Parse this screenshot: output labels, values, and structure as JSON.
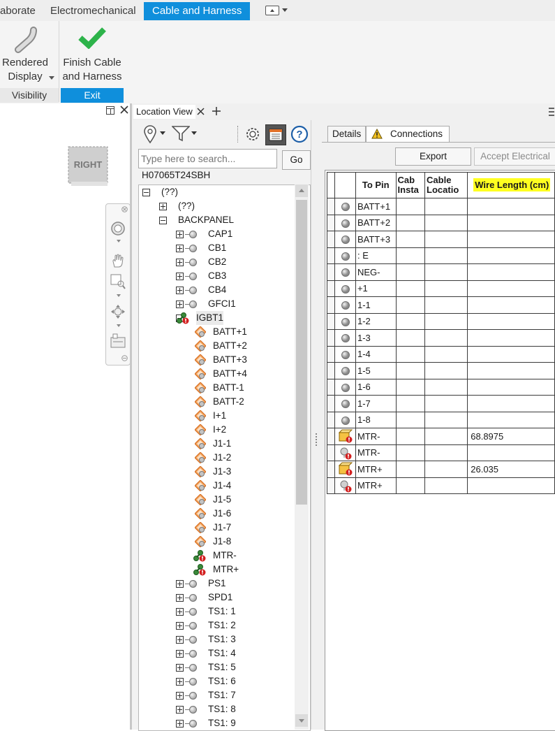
{
  "ribbon": {
    "tabs": [
      "aborate",
      "Electromechanical",
      "Cable and Harness"
    ],
    "active_tab": "Cable and Harness",
    "rendered_display_line1": "Rendered",
    "rendered_display_line2": "Display",
    "finish_line1": "Finish Cable",
    "finish_line2": "and Harness",
    "visibility_label": "Visibility",
    "exit_label": "Exit"
  },
  "viewcube": {
    "face_label": "RIGHT"
  },
  "location_view": {
    "tab_label": "Location View",
    "search_placeholder": "Type here to search...",
    "go_label": "Go",
    "assembly_name": "H07065T24SBH",
    "tree": [
      {
        "level": 0,
        "expander": "minus",
        "icon": "none",
        "label": "(??)"
      },
      {
        "level": 1,
        "expander": "plus",
        "icon": "none",
        "label": "(??)"
      },
      {
        "level": 1,
        "expander": "minus",
        "icon": "none",
        "label": "BACKPANEL"
      },
      {
        "level": 2,
        "expander": "plus",
        "icon": "node",
        "label": "CAP1"
      },
      {
        "level": 2,
        "expander": "plus",
        "icon": "node",
        "label": "CB1"
      },
      {
        "level": 2,
        "expander": "plus",
        "icon": "node",
        "label": "CB2"
      },
      {
        "level": 2,
        "expander": "plus",
        "icon": "node",
        "label": "CB3"
      },
      {
        "level": 2,
        "expander": "plus",
        "icon": "node",
        "label": "CB4"
      },
      {
        "level": 2,
        "expander": "plus",
        "icon": "node",
        "label": "GFCI1"
      },
      {
        "level": 2,
        "expander": "minus",
        "icon": "wire-error",
        "label": "IGBT1"
      },
      {
        "level": 3,
        "expander": "none",
        "icon": "pin",
        "label": "BATT+1"
      },
      {
        "level": 3,
        "expander": "none",
        "icon": "pin",
        "label": "BATT+2"
      },
      {
        "level": 3,
        "expander": "none",
        "icon": "pin",
        "label": "BATT+3"
      },
      {
        "level": 3,
        "expander": "none",
        "icon": "pin",
        "label": "BATT+4"
      },
      {
        "level": 3,
        "expander": "none",
        "icon": "pin",
        "label": "BATT-1"
      },
      {
        "level": 3,
        "expander": "none",
        "icon": "pin",
        "label": "BATT-2"
      },
      {
        "level": 3,
        "expander": "none",
        "icon": "pin",
        "label": "I+1"
      },
      {
        "level": 3,
        "expander": "none",
        "icon": "pin",
        "label": "I+2"
      },
      {
        "level": 3,
        "expander": "none",
        "icon": "pin",
        "label": "J1-1"
      },
      {
        "level": 3,
        "expander": "none",
        "icon": "pin",
        "label": "J1-2"
      },
      {
        "level": 3,
        "expander": "none",
        "icon": "pin",
        "label": "J1-3"
      },
      {
        "level": 3,
        "expander": "none",
        "icon": "pin",
        "label": "J1-4"
      },
      {
        "level": 3,
        "expander": "none",
        "icon": "pin",
        "label": "J1-5"
      },
      {
        "level": 3,
        "expander": "none",
        "icon": "pin",
        "label": "J1-6"
      },
      {
        "level": 3,
        "expander": "none",
        "icon": "pin",
        "label": "J1-7"
      },
      {
        "level": 3,
        "expander": "none",
        "icon": "pin",
        "label": "J1-8"
      },
      {
        "level": 3,
        "expander": "none",
        "icon": "wire-error",
        "label": "MTR-"
      },
      {
        "level": 3,
        "expander": "none",
        "icon": "wire-error",
        "label": "MTR+"
      },
      {
        "level": 2,
        "expander": "plus",
        "icon": "node",
        "label": "PS1"
      },
      {
        "level": 2,
        "expander": "plus",
        "icon": "node",
        "label": "SPD1"
      },
      {
        "level": 2,
        "expander": "plus",
        "icon": "node",
        "label": "TS1: 1"
      },
      {
        "level": 2,
        "expander": "plus",
        "icon": "node",
        "label": "TS1: 2"
      },
      {
        "level": 2,
        "expander": "plus",
        "icon": "node",
        "label": "TS1: 3"
      },
      {
        "level": 2,
        "expander": "plus",
        "icon": "node",
        "label": "TS1: 4"
      },
      {
        "level": 2,
        "expander": "plus",
        "icon": "node",
        "label": "TS1: 5"
      },
      {
        "level": 2,
        "expander": "plus",
        "icon": "node",
        "label": "TS1: 6"
      },
      {
        "level": 2,
        "expander": "plus",
        "icon": "node",
        "label": "TS1: 7"
      },
      {
        "level": 2,
        "expander": "plus",
        "icon": "node",
        "label": "TS1: 8"
      },
      {
        "level": 2,
        "expander": "plus",
        "icon": "node",
        "label": "TS1: 9"
      }
    ]
  },
  "connections": {
    "details_tab": "Details",
    "connections_tab": "Connections",
    "export_label": "Export",
    "accept_label": "Accept Electrical",
    "headers": {
      "to_pin": "To Pin",
      "cable_inst_1": "Cab",
      "cable_inst_2": "Insta",
      "cable_loc_1": "Cable",
      "cable_loc_2": "Locatio",
      "wire_length": "Wire Length (cm)"
    },
    "rows": [
      {
        "icon": "node",
        "to_pin": "BATT+1",
        "wire_length": ""
      },
      {
        "icon": "node",
        "to_pin": "BATT+2",
        "wire_length": ""
      },
      {
        "icon": "node",
        "to_pin": "BATT+3",
        "wire_length": ""
      },
      {
        "icon": "node",
        "to_pin": ": E",
        "wire_length": ""
      },
      {
        "icon": "node",
        "to_pin": "NEG-",
        "wire_length": ""
      },
      {
        "icon": "node",
        "to_pin": "+1",
        "wire_length": ""
      },
      {
        "icon": "node",
        "to_pin": "1-1",
        "wire_length": ""
      },
      {
        "icon": "node",
        "to_pin": "1-2",
        "wire_length": ""
      },
      {
        "icon": "node",
        "to_pin": "1-3",
        "wire_length": ""
      },
      {
        "icon": "node",
        "to_pin": "1-4",
        "wire_length": ""
      },
      {
        "icon": "node",
        "to_pin": "1-5",
        "wire_length": ""
      },
      {
        "icon": "node",
        "to_pin": "1-6",
        "wire_length": ""
      },
      {
        "icon": "node",
        "to_pin": "1-7",
        "wire_length": ""
      },
      {
        "icon": "node",
        "to_pin": "1-8",
        "wire_length": ""
      },
      {
        "icon": "box-error",
        "to_pin": "MTR-",
        "wire_length": "68.8975"
      },
      {
        "icon": "node-error",
        "to_pin": "MTR-",
        "wire_length": ""
      },
      {
        "icon": "box-error",
        "to_pin": "MTR+",
        "wire_length": "26.035"
      },
      {
        "icon": "node-error",
        "to_pin": "MTR+",
        "wire_length": ""
      }
    ]
  },
  "colors": {
    "accent": "#0f8fdc",
    "highlight": "#ffff20",
    "check_green": "#2db34a",
    "pin_orange": "#f08a2c"
  }
}
